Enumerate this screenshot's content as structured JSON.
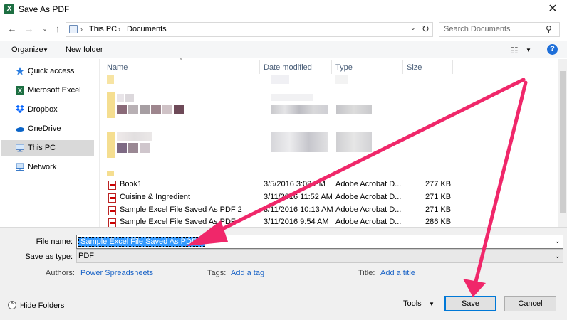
{
  "window": {
    "title": "Save As PDF",
    "app_icon_glyph": "X",
    "close_glyph": "✕"
  },
  "address": {
    "crumbs": [
      "This PC",
      "Documents"
    ],
    "search_placeholder": "Search Documents"
  },
  "toolbar": {
    "organize_label": "Organize",
    "new_folder_label": "New folder",
    "help_glyph": "?"
  },
  "nav": {
    "items": [
      {
        "label": "Quick access",
        "icon": "star-icon"
      },
      {
        "label": "Microsoft Excel",
        "icon": "excel-icon"
      },
      {
        "label": "Dropbox",
        "icon": "dropbox-icon"
      },
      {
        "label": "OneDrive",
        "icon": "cloud-icon"
      },
      {
        "label": "This PC",
        "icon": "computer-icon",
        "selected": true
      },
      {
        "label": "Network",
        "icon": "network-icon"
      }
    ]
  },
  "columns": {
    "name": "Name",
    "date": "Date modified",
    "type": "Type",
    "size": "Size"
  },
  "files": [
    {
      "name": "Book1",
      "date": "3/5/2016 3:08 PM",
      "type": "Adobe Acrobat D...",
      "size": "277 KB"
    },
    {
      "name": "Cuisine & Ingredient",
      "date": "3/11/2016 11:52 AM",
      "type": "Adobe Acrobat D...",
      "size": "271 KB"
    },
    {
      "name": "Sample Excel File Saved As PDF 2",
      "date": "3/11/2016 10:13 AM",
      "type": "Adobe Acrobat D...",
      "size": "271 KB"
    },
    {
      "name": "Sample Excel File Saved As PDF",
      "date": "3/11/2016 9:54 AM",
      "type": "Adobe Acrobat D...",
      "size": "286 KB"
    }
  ],
  "form": {
    "file_name_label": "File name:",
    "file_name_value": "Sample Excel File Saved As PDF 5",
    "save_type_label": "Save as type:",
    "save_type_value": "PDF",
    "authors_label": "Authors:",
    "authors_value": "Power Spreadsheets",
    "tags_label": "Tags:",
    "tags_value": "Add a tag",
    "title_label": "Title:",
    "title_value": "Add a title"
  },
  "footer": {
    "hide_folders_label": "Hide Folders",
    "tools_label": "Tools",
    "save_label": "Save",
    "cancel_label": "Cancel"
  },
  "colors": {
    "accent": "#0078d7",
    "annotation_arrow": "#f0276a",
    "selection": "#3399ff",
    "link": "#1e66c7"
  }
}
